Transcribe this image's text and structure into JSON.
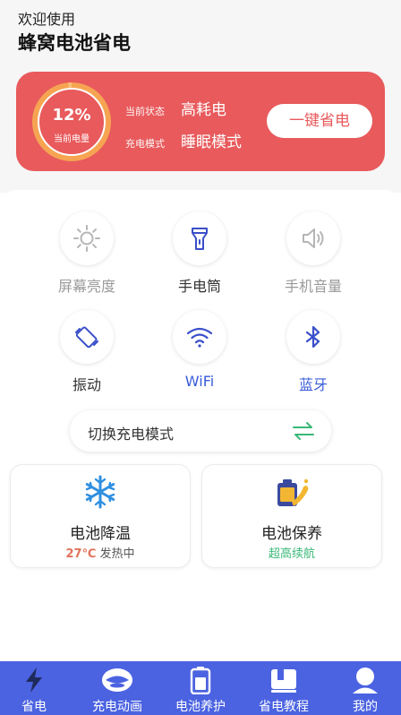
{
  "header": {
    "welcome": "欢迎使用",
    "app_name": "蜂窝电池省电"
  },
  "battery_card": {
    "percent": "12%",
    "level_fraction": 0.12,
    "level_label": "当前电量",
    "status_key": "当前状态",
    "status_value": "高耗电",
    "mode_key": "充电模式",
    "mode_value": "睡眠模式",
    "save_button": "一键省电"
  },
  "tools": [
    {
      "label": "屏幕亮度",
      "icon": "brightness-icon"
    },
    {
      "label": "手电筒",
      "icon": "flashlight-icon"
    },
    {
      "label": "手机音量",
      "icon": "volume-icon"
    },
    {
      "label": "振动",
      "icon": "vibration-icon"
    },
    {
      "label": "WiFi",
      "icon": "wifi-icon"
    },
    {
      "label": "蓝牙",
      "icon": "bluetooth-icon"
    }
  ],
  "switch_mode": {
    "label": "切换充电模式",
    "icon": "swap-icon"
  },
  "features": [
    {
      "name": "电池降温",
      "sub_value": "27℃",
      "sub_suffix": " 发热中",
      "icon": "snowflake-icon"
    },
    {
      "name": "电池保养",
      "sub": "超高续航",
      "icon": "battery-care-icon"
    }
  ],
  "tabs": [
    {
      "label": "省电",
      "icon": "bolt-icon"
    },
    {
      "label": "充电动画",
      "icon": "animation-icon"
    },
    {
      "label": "电池养护",
      "icon": "battery-icon"
    },
    {
      "label": "省电教程",
      "icon": "book-icon"
    },
    {
      "label": "我的",
      "icon": "profile-icon"
    }
  ],
  "colors": {
    "accent_red": "#e85a5c",
    "accent_blue": "#4b63e1",
    "ring_orange": "#f6a452",
    "green": "#3ab878"
  }
}
